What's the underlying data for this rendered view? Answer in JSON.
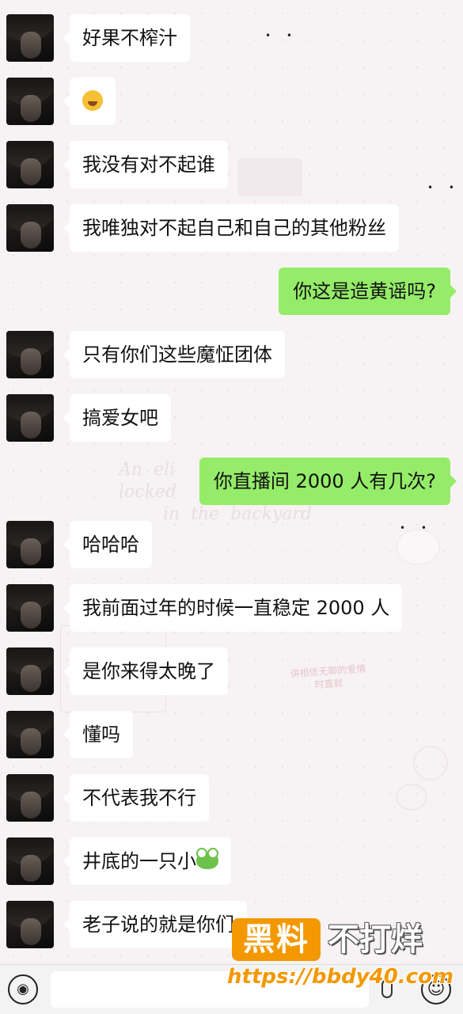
{
  "messages": [
    {
      "side": "in",
      "text": "好果不榨汁"
    },
    {
      "side": "in",
      "text": "",
      "emoji": "laughing-crying-emoji"
    },
    {
      "side": "in",
      "text": "我没有对不起谁"
    },
    {
      "side": "in",
      "text": "我唯独对不起自己和自己的其他粉丝"
    },
    {
      "side": "out",
      "text": "你这是造黄谣吗?"
    },
    {
      "side": "in",
      "text": "只有你们这些魔怔团体"
    },
    {
      "side": "in",
      "text": "搞爱女吧"
    },
    {
      "side": "out",
      "text": "你直播间 2000 人有几次?"
    },
    {
      "side": "in",
      "text": "哈哈哈"
    },
    {
      "side": "in",
      "text": "我前面过年的时候一直稳定 2000 人"
    },
    {
      "side": "in",
      "text": "是你来得太晚了"
    },
    {
      "side": "in",
      "text": "懂吗"
    },
    {
      "side": "in",
      "text": "不代表我不行"
    },
    {
      "side": "in",
      "text": "井底的一只小",
      "emoji": "frog-emoji"
    },
    {
      "side": "in",
      "text": "老子说的就是你们"
    }
  ],
  "background_text": {
    "script_lines": "An  eli\nlocked\n        in  the  backyard",
    "red_note": "讲相信无聊的爱情\n时直就"
  },
  "input_bar": {
    "voice_icon": "voice-icon",
    "mic_icon": "mic-icon",
    "emoji_icon": "smiley-icon"
  },
  "watermark": {
    "badge": "黑料",
    "text": "不打烊",
    "url": "https://bbdy40.com"
  },
  "colors": {
    "outgoing_bubble": "#95ec69",
    "incoming_bubble": "#ffffff",
    "watermark_orange": "#f39800"
  }
}
